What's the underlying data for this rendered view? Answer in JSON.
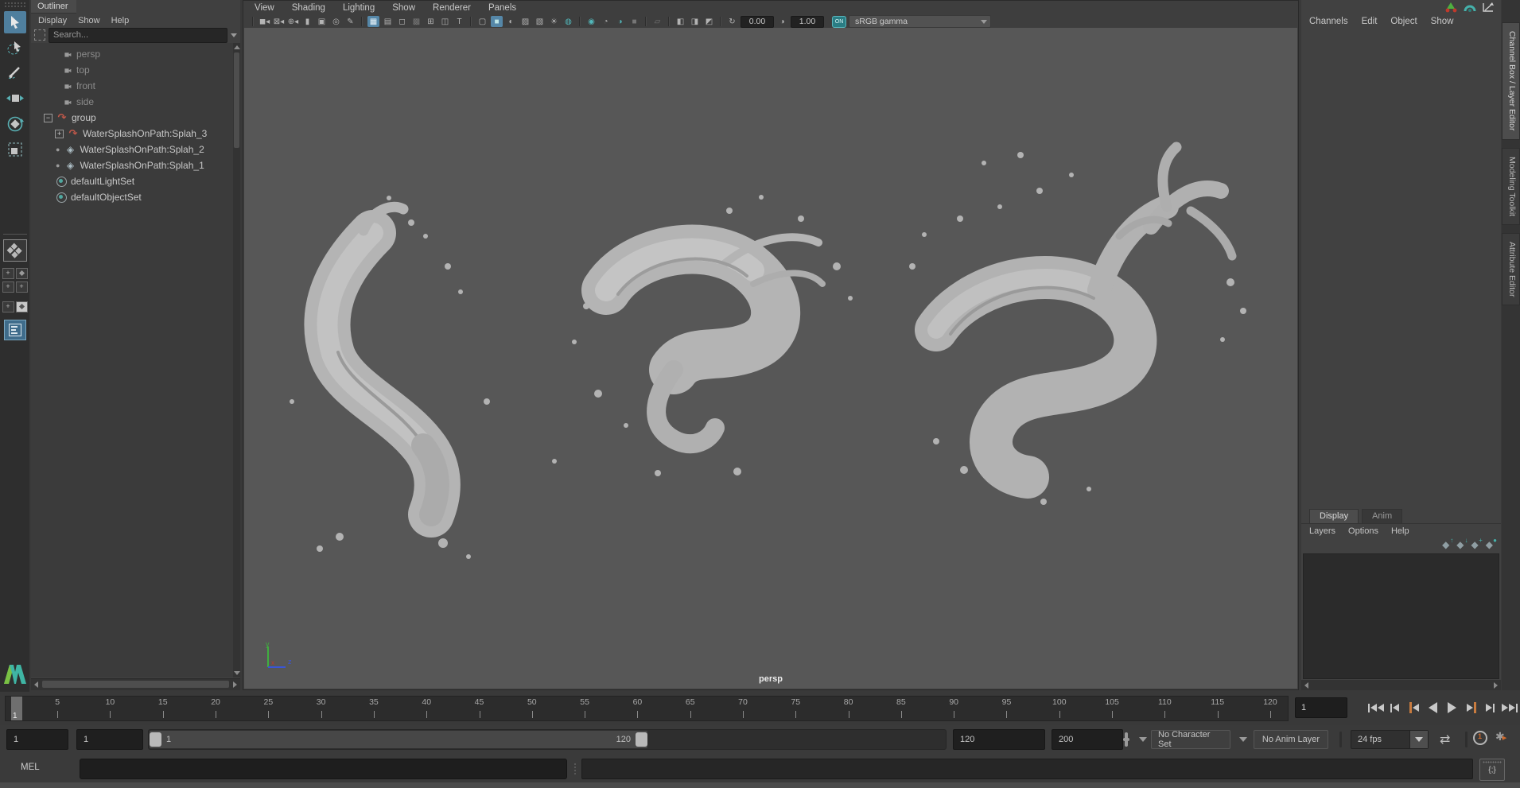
{
  "colors": {
    "accent_blue": "#5587a8",
    "accent_teal": "#52b7ba",
    "accent_orange": "#c87b3f",
    "viewport_bg": "#575757"
  },
  "outliner": {
    "title": "Outliner",
    "menus": [
      "Display",
      "Show",
      "Help"
    ],
    "search_placeholder": "Search...",
    "items": [
      {
        "label": "persp",
        "cls": "dim icam ind1"
      },
      {
        "label": "top",
        "cls": "dim icam ind1"
      },
      {
        "label": "front",
        "cls": "dim icam ind1"
      },
      {
        "label": "side",
        "cls": "dim icam ind1"
      },
      {
        "label": "group",
        "cls": "itrans ind0 expminus"
      },
      {
        "label": "WaterSplashOnPath:Splah_3",
        "cls": "itrans ind2 expplus"
      },
      {
        "label": "WaterSplashOnPath:Splah_2",
        "cls": "imesh ind2 bullet"
      },
      {
        "label": "WaterSplashOnPath:Splah_1",
        "cls": "imesh ind2 bullet"
      },
      {
        "label": "defaultLightSet",
        "cls": "iset ind05"
      },
      {
        "label": "defaultObjectSet",
        "cls": "iset ind05"
      }
    ]
  },
  "viewport": {
    "menus": [
      "View",
      "Shading",
      "Lighting",
      "Show",
      "Renderer",
      "Panels"
    ],
    "exposure": "0.00",
    "gamma": "1.00",
    "gamma_on_label": "ON",
    "view_transform": "sRGB gamma",
    "camera_label": "persp"
  },
  "right_panel": {
    "menus": [
      "Channels",
      "Edit",
      "Object",
      "Show"
    ],
    "side_tabs": [
      {
        "label": "Channel Box / Layer Editor",
        "cls": "active"
      },
      {
        "label": "Modeling Toolkit",
        "cls": ""
      },
      {
        "label": "Attribute Editor",
        "cls": ""
      }
    ],
    "layer_tabs": [
      {
        "label": "Display",
        "cls": "active"
      },
      {
        "label": "Anim",
        "cls": ""
      }
    ],
    "layer_menus": [
      "Layers",
      "Options",
      "Help"
    ]
  },
  "timeline": {
    "playhead_frame": "1",
    "tick_labels": [
      "5",
      "10",
      "15",
      "20",
      "25",
      "30",
      "35",
      "40",
      "45",
      "50",
      "55",
      "60",
      "65",
      "70",
      "75",
      "80",
      "85",
      "90",
      "95",
      "100",
      "105",
      "110",
      "115",
      "120"
    ],
    "current_frame": "1",
    "anim_start": "1",
    "playback_start": "1",
    "range_handle_start": "1",
    "range_handle_end": "120",
    "playback_end": "120",
    "anim_end": "200",
    "character_set": "No Character Set",
    "anim_layer": "No Anim Layer",
    "fps": "24 fps"
  },
  "command_line": {
    "label": "MEL"
  }
}
